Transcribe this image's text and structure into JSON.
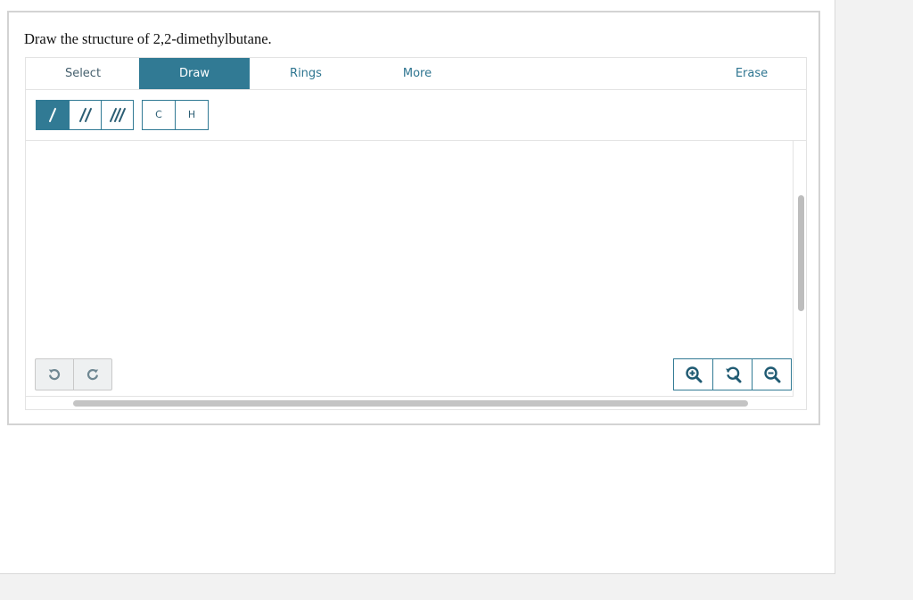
{
  "question": {
    "text": "Draw the structure of 2,2-dimethylbutane."
  },
  "tabs": [
    {
      "label": "Select",
      "active": false
    },
    {
      "label": "Draw",
      "active": true
    },
    {
      "label": "Rings",
      "active": false
    },
    {
      "label": "More",
      "active": false
    },
    {
      "label": "Erase",
      "active": false
    }
  ],
  "bond_tools": [
    {
      "icon": "single-bond-icon",
      "active": true
    },
    {
      "icon": "double-bond-icon",
      "active": false
    },
    {
      "icon": "triple-bond-icon",
      "active": false
    }
  ],
  "atom_tools": {
    "carbon": "C",
    "hydrogen": "H"
  },
  "history": {
    "undo_icon": "undo-icon",
    "redo_icon": "redo-icon"
  },
  "zoom": {
    "zoom_in_icon": "zoom-in-icon",
    "reset_icon": "zoom-reset-icon",
    "zoom_out_icon": "zoom-out-icon"
  },
  "colors": {
    "accent": "#317a94",
    "tab_text": "#2e7590"
  }
}
